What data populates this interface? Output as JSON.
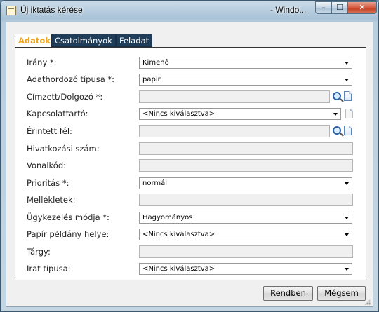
{
  "window": {
    "title": "Új iktatás kérése",
    "title_right": "- Windo...",
    "minimize_glyph": "–",
    "maximize_glyph": "☐",
    "close_glyph": "✕"
  },
  "tabs": [
    {
      "label": "Adatok",
      "active": true
    },
    {
      "label": "Csatolmányok",
      "active": false
    },
    {
      "label": "Feladat",
      "active": false
    }
  ],
  "form": {
    "irany": {
      "label": "Irány *:",
      "value": "Kimenő"
    },
    "adathordozo": {
      "label": "Adathordozó típusa *:",
      "value": "papír"
    },
    "cimzett": {
      "label": "Címzett/Dolgozó *:",
      "value": ""
    },
    "kapcsolattarto": {
      "label": "Kapcsolattartó:",
      "value": "<Nincs kiválasztva>"
    },
    "erintett": {
      "label": "Érintett fél:",
      "value": ""
    },
    "hivatkozasi": {
      "label": "Hivatkozási szám:",
      "value": ""
    },
    "vonalkod": {
      "label": "Vonalkód:",
      "value": ""
    },
    "prioritas": {
      "label": "Prioritás *:",
      "value": "normál"
    },
    "mellekletek": {
      "label": "Mellékletek:",
      "value": ""
    },
    "ugykezeles": {
      "label": "Ügykezelés módja *:",
      "value": "Hagyományos"
    },
    "papir_helye": {
      "label": "Papír példány helye:",
      "value": "<Nincs kiválasztva>"
    },
    "targy": {
      "label": "Tárgy:",
      "value": ""
    },
    "irat_tipusa": {
      "label": "Irat típusa:",
      "value": "<Nincs kiválasztva>"
    }
  },
  "buttons": {
    "ok": "Rendben",
    "cancel": "Mégsem"
  },
  "colors": {
    "active_tab_text": "#f0a21a",
    "inactive_tab_bg": "#1f3c58",
    "icon_blue": "#2a62a8"
  }
}
